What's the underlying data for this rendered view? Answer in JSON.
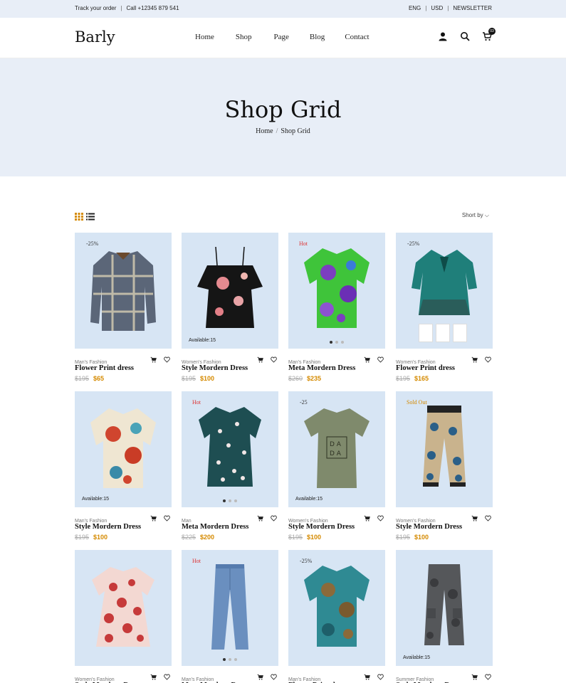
{
  "topbar": {
    "track": "Track your order",
    "divider": "|",
    "call": "Call +12345 879 541",
    "lang": "ENG",
    "currency": "USD",
    "newsletter": "NEWSLETTER",
    "sep": "|"
  },
  "header": {
    "logo": "Barly",
    "nav": [
      "Home",
      "Shop",
      "Page",
      "Blog",
      "Contact"
    ],
    "cart_count": "03"
  },
  "banner": {
    "title": "Shop Grid",
    "breadcrumb_home": "Home",
    "breadcrumb_sep": "/",
    "breadcrumb_current": "Shop Grid"
  },
  "toolbar": {
    "sort_label": "Short by",
    "sort_arrow": "⌵"
  },
  "colors": {
    "accent": "#d58a00",
    "hot": "#dd3333",
    "card_bg": "#d7e5f4",
    "banner_bg": "#e8eef7"
  },
  "products": [
    {
      "tag": "-25%",
      "category": "Man's Fashion",
      "name": "Flower Print dress",
      "old": "$195",
      "price": "$65"
    },
    {
      "avail": "Available:15",
      "category": "Women's Fashion",
      "name": "Style Mordern Dress",
      "old": "$195",
      "price": "$100"
    },
    {
      "tag": "Hot",
      "category": "Man's Fashion",
      "name": "Meta Mordern Dress",
      "old": "$260",
      "price": "$235"
    },
    {
      "tag": "-25%",
      "category": "Women's Fashion",
      "name": "Flower Print dress",
      "old": "$195",
      "price": "$165"
    },
    {
      "avail": "Available:15",
      "category": "Man's Fashion",
      "name": "Style Mordern Dress",
      "old": "$195",
      "price": "$100"
    },
    {
      "tag": "Hot",
      "category": "Man",
      "name": "Meta Mordern Dress",
      "old": "$225",
      "price": "$200"
    },
    {
      "tag": "-25",
      "avail": "Available:15",
      "category": "Women's Fashion",
      "name": "Style Mordern Dress",
      "old": "$195",
      "price": "$100"
    },
    {
      "tag": "Sold Out",
      "category": "Women's Fashion",
      "name": "Style Mordern Dress",
      "old": "$195",
      "price": "$100"
    },
    {
      "category": "Women's Fashion",
      "name": "Style Mordern Dress",
      "old": "",
      "price": ""
    },
    {
      "tag": "Hot",
      "category": "Man's Fashion",
      "name": "Meta Mordern Dress",
      "old": "",
      "price": ""
    },
    {
      "tag": "-25%",
      "category": "Man's Fashion",
      "name": "Flower Print dress",
      "old": "",
      "price": ""
    },
    {
      "avail": "Available:15",
      "category": "Summer Fashion",
      "name": "Style Mordern Dress",
      "old": "",
      "price": ""
    }
  ]
}
